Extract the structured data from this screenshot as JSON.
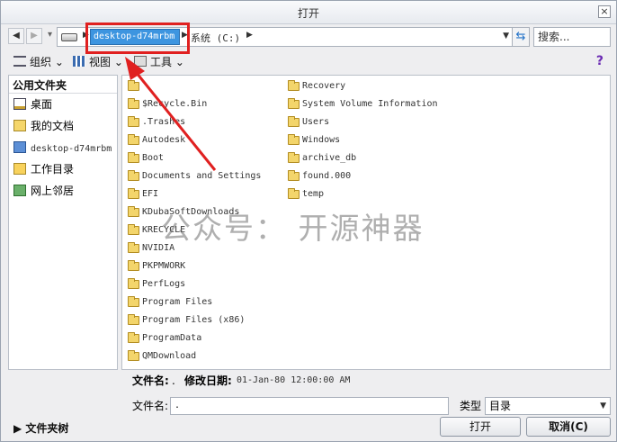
{
  "window": {
    "title": "打开",
    "close_glyph": "×"
  },
  "nav": {
    "back_glyph": "◀",
    "forward_glyph": "▶",
    "breadcrumb": {
      "active": "desktop-d74mrbm",
      "second": "系统 (C:)"
    },
    "search_placeholder": "搜索..."
  },
  "toolbar": {
    "organize": "组织",
    "view": "视图",
    "tools": "工具",
    "dropdown_glyph": "⌄"
  },
  "sidebar": {
    "header": "公用文件夹",
    "items": [
      {
        "label": "桌面",
        "icon": "desktop-icon"
      },
      {
        "label": "我的文档",
        "icon": "documents-icon"
      },
      {
        "label": "desktop-d74mrbm",
        "icon": "computer-icon"
      },
      {
        "label": "工作目录",
        "icon": "work-folder-icon"
      },
      {
        "label": "网上邻居",
        "icon": "network-icon"
      }
    ]
  },
  "files": {
    "col_a": [
      "$Recycle.Bin",
      ".Trashes",
      "Autodesk",
      "Boot",
      "Documents and Settings",
      "EFI",
      "KDubaSoftDownloads",
      "KRECYCLE",
      "NVIDIA",
      "PKPMWORK",
      "PerfLogs",
      "Program Files",
      "Program Files (x86)",
      "ProgramData",
      "QMDownload"
    ],
    "col_b": [
      "Recovery",
      "System Volume Information",
      "Users",
      "Windows",
      "archive_db",
      "found.000",
      "temp"
    ]
  },
  "watermark": "公众号： 开源神器",
  "details": {
    "filename_label": "文件名:",
    "filename_value": ".",
    "modified_label": "修改日期:",
    "modified_value": "01-Jan-80 12:00:00 AM"
  },
  "filename_row": {
    "label": "文件名:",
    "value": ".",
    "type_label": "类型",
    "type_value": "目录"
  },
  "buttons": {
    "folder_tree": "文件夹树",
    "open": "打开",
    "cancel": "取消(C)"
  },
  "colors": {
    "accent": "#3d95e0",
    "highlight_red": "#e02020"
  }
}
